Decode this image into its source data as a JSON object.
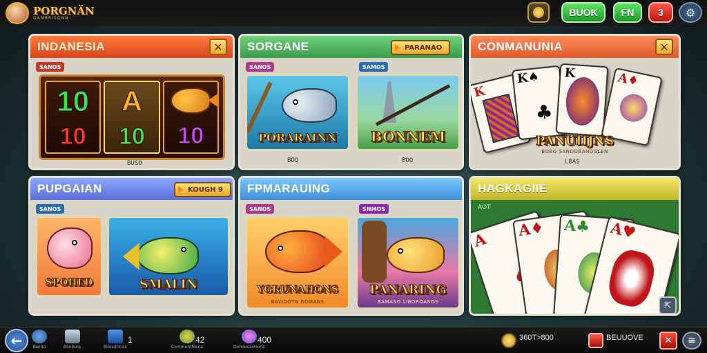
{
  "app": {
    "logo_title": "PORGNÄN",
    "logo_sub": "GAMBRISONN"
  },
  "topbar": {
    "book_label": "BUOK",
    "fn_label": "FN",
    "red_label": "3",
    "gear_icon": "gear-icon",
    "coin_icon": "coin-icon"
  },
  "panels": {
    "indanesia": {
      "title": "INDANESIA",
      "tag": "SANOS",
      "symbols_top": [
        "10",
        "A"
      ],
      "symbols_bottom": [
        "10",
        "10",
        "10"
      ],
      "footer": "BUSO"
    },
    "sorgane": {
      "title": "SORGANE",
      "ribbon": "PARANAO",
      "tag_left": "SANOS",
      "tag_right": "SAMOS",
      "game_left": "PORARAINN",
      "game_right": "BONNEM",
      "footer_left": "BOO",
      "footer_right": "BOO"
    },
    "conmanunia": {
      "title": "CONMANUNIA",
      "game_title": "PANUIIJNS",
      "game_sub": "BOBO SANDOBANDOLEN",
      "footer": "LBAS"
    },
    "pupgaian": {
      "title": "PUPGAIAN",
      "ribbon": "KOUGH 9",
      "tag": "SANOS",
      "game_left": "SPOHED",
      "game_right": "SMALIN"
    },
    "fpmarauing": {
      "title": "FPMARAUING",
      "tag_left": "SANOS",
      "tag_right": "SNMOS",
      "game_left": "YGRUNAHONS",
      "game_left_sub": "BAVIDOTN ROMANS",
      "game_right": "PANARING",
      "game_right_sub": "BAMANG LIBOROANOS"
    },
    "hagkagiie": {
      "title": "HAGKAGIIE",
      "tag": "AOT"
    }
  },
  "bottombar": {
    "items": [
      {
        "caption": "Bwnto"
      },
      {
        "caption": "Bonbore"
      },
      {
        "caption": "Blonstrlnas",
        "value": "1"
      },
      {
        "caption": "Communthlena",
        "value": "42"
      },
      {
        "caption": "Donoosantrons",
        "value": "400"
      }
    ],
    "coins": "360T>800",
    "gems": "BEUUOVE"
  },
  "colors": {
    "gold": "#f4c542",
    "green_button": "#1c9a26",
    "red_button": "#b9160f",
    "felt": "#2f7a32"
  }
}
